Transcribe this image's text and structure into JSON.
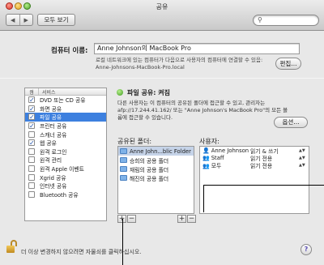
{
  "window": {
    "title": "공유"
  },
  "toolbar": {
    "back_label": "◀",
    "forward_label": "▶",
    "show_all_label": "모두 보기",
    "search_placeholder": ""
  },
  "computer_name": {
    "label": "컴퓨터 이름:",
    "value": "Anne Johnson의 MacBook Pro",
    "description": "로컬 네트워크에 있는 컴퓨터가 다음으로 사용자의 컴퓨터에 연결할 수 있음: Anne-Johnsons-MacBook-Pro.local",
    "edit_label": "편집..."
  },
  "services": {
    "header_on": "켬",
    "header_service": "서비스",
    "items": [
      {
        "label": "DVD 또는 CD 공유",
        "checked": true,
        "selected": false
      },
      {
        "label": "화면 공유",
        "checked": true,
        "selected": false
      },
      {
        "label": "파일 공유",
        "checked": true,
        "selected": true
      },
      {
        "label": "프린터 공유",
        "checked": true,
        "selected": false
      },
      {
        "label": "스캐너 공유",
        "checked": false,
        "selected": false
      },
      {
        "label": "웹 공유",
        "checked": true,
        "selected": false
      },
      {
        "label": "원격 로그인",
        "checked": false,
        "selected": false
      },
      {
        "label": "원격 관리",
        "checked": false,
        "selected": false
      },
      {
        "label": "원격 Apple 이벤트",
        "checked": false,
        "selected": false
      },
      {
        "label": "Xgrid 공유",
        "checked": false,
        "selected": false
      },
      {
        "label": "인터넷 공유",
        "checked": false,
        "selected": false
      },
      {
        "label": "Bluetooth 공유",
        "checked": false,
        "selected": false
      }
    ]
  },
  "file_sharing": {
    "status": "파일 공유: 켜짐",
    "info": "다른 사용자는 이 컴퓨터의 공유된 폴더에 접근할 수 있고, 관리자는 afp://17.244.41.162/ 또는 \"Anne Johnson's MacBook Pro\"의 모든 볼륨에 접근할 수 있습니다.",
    "options_label": "옵션...",
    "folders_label": "공유된 폴더:",
    "folders": [
      "Anne John...blic Folder",
      "승희의 공용 폴더",
      "재림의 공용 폴더",
      "해진의 공용 폴더"
    ],
    "users_label": "사용자:",
    "users": [
      {
        "icon": "user-icon",
        "name": "Anne Johnson",
        "permission": "읽기 & 쓰기"
      },
      {
        "icon": "group-icon",
        "name": "Staff",
        "permission": "읽기 전용"
      },
      {
        "icon": "group-icon",
        "name": "모두",
        "permission": "읽기 전용"
      }
    ],
    "add_label": "+",
    "remove_label": "−"
  },
  "footer": {
    "lock_text": "더 이상 변경하지 않으려면 자물쇠를 클릭하십시오.",
    "help_label": "?"
  },
  "colors": {
    "selection": "#3d80df",
    "status_green": "#3e9a1e"
  }
}
